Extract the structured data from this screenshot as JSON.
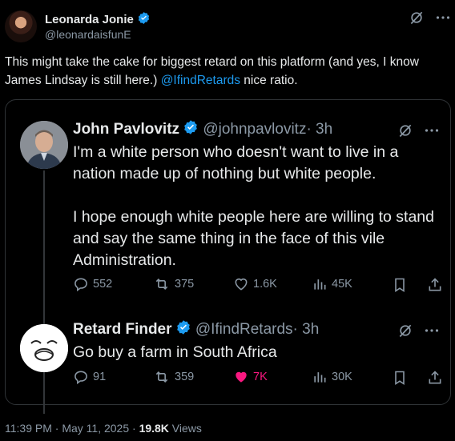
{
  "author": {
    "name": "Leonarda Jonie",
    "handle": "@leonardaisfunE"
  },
  "post": {
    "text_before": "This might take the cake for biggest retard on this platform (and yes, I know James Lindsay is still here.) ",
    "mention": "@IfindRetards",
    "text_after": " nice ratio."
  },
  "quote": {
    "tweets": [
      {
        "name": "John Pavlovitz",
        "handle": "@johnpavlovitz",
        "time": "· 3h",
        "paragraphs": [
          "I'm a white person who doesn't want to live in a nation made up of nothing but white people.",
          "I hope enough white people here are willing to stand and say the same thing in the face of this vile Administration."
        ],
        "replies": "552",
        "reposts": "375",
        "likes": "1.6K",
        "views": "45K"
      },
      {
        "name": "Retard Finder",
        "handle": "@IfindRetards",
        "time": "· 3h",
        "paragraphs": [
          "Go buy a farm in South Africa"
        ],
        "replies": "91",
        "reposts": "359",
        "likes": "7K",
        "views": "30K"
      }
    ]
  },
  "footer": {
    "time": "11:39 PM · May 11, 2025 · ",
    "views_count": "19.8K",
    "views_label": " Views"
  },
  "colors": {
    "background": "#000000",
    "text": "#e7e9ea",
    "muted": "#8b98a5",
    "link": "#1d9bf0",
    "like": "#f91880",
    "verified": "#1d9bf0"
  },
  "icons": [
    "verified-badge-icon",
    "grok-icon",
    "more-icon",
    "reply-icon",
    "repost-icon",
    "like-icon",
    "views-icon",
    "bookmark-icon",
    "share-icon"
  ]
}
